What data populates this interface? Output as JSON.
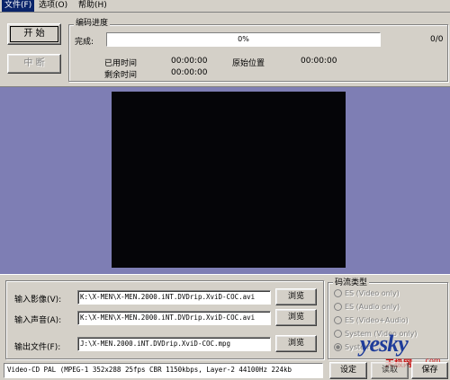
{
  "menu": {
    "file": "文件(F)",
    "options": "选项(O)",
    "help": "帮助(H)"
  },
  "controls": {
    "start": "开 始",
    "abort": "中 断"
  },
  "progress": {
    "group_title": "编码进度",
    "complete_label": "完成:",
    "percent_text": "0%",
    "fraction": 0,
    "count": "0/0",
    "elapsed_label": "已用时间",
    "elapsed_value": "00:00:00",
    "original_pos_label": "原始位置",
    "original_pos_value": "00:00:00",
    "remaining_label": "剩余时间",
    "remaining_value": "00:00:00"
  },
  "files": {
    "video_label": "输入影像(V):",
    "video_value": "K:\\X-MEN\\X-MEN.2000.iNT.DVDrip.XviD-COC.avi",
    "audio_label": "输入声音(A):",
    "audio_value": "K:\\X-MEN\\X-MEN.2000.iNT.DVDrip.XviD-COC.avi",
    "output_label": "输出文件(F):",
    "output_value": "J:\\X-MEN.2000.iNT.DVDrip.XviD-COC.mpg",
    "browse": "浏览"
  },
  "stream_type": {
    "title": "码流类型",
    "options": [
      "ES (Video only)",
      "ES (Audio only)",
      "ES (Video+Audio)",
      "System (Video only)",
      "System"
    ]
  },
  "status": {
    "text": "Video-CD PAL (MPEG-1 352x288 25fps CBR 1150kbps,  Layer-2 44100Hz 224kb"
  },
  "bottom_buttons": {
    "settings": "设定",
    "load": "读取",
    "save": "保存"
  },
  "watermark": {
    "brand": "yesky",
    "brand_sub": "天极网",
    "domain": ".com"
  },
  "colors": {
    "video_area_bg": "#7e7eb4",
    "video_frame_bg": "#050508",
    "menu_active": "#0a246a",
    "window_bg": "#d4d0c8"
  }
}
